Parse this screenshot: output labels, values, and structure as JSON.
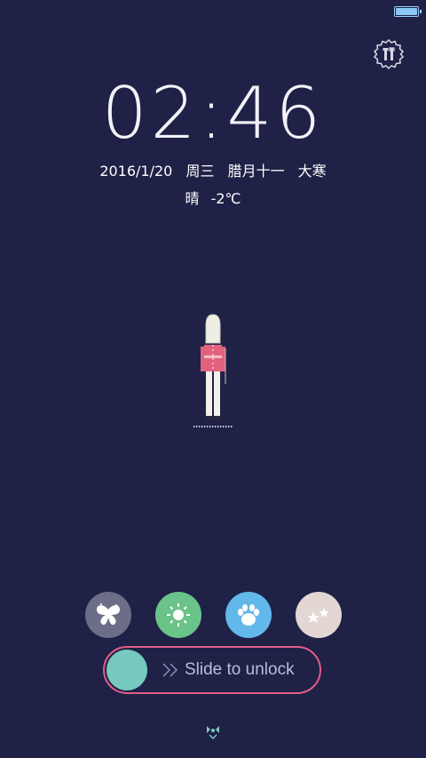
{
  "status_bar": {
    "battery_level": 1.0,
    "battery_color": "#8cc8f5"
  },
  "lockscreen": {
    "time": "02:46",
    "date": "2016/1/20",
    "weekday": "周三",
    "lunar_date": "腊月十一",
    "solar_term": "大寒",
    "weather": "晴",
    "temperature": "-2℃"
  },
  "themes": [
    {
      "icon": "butterfly-icon",
      "color": "#6b6e86"
    },
    {
      "icon": "sun-icon",
      "color": "#6ac388"
    },
    {
      "icon": "paw-icon",
      "color": "#62b8ea"
    },
    {
      "icon": "stars-icon",
      "color": "#e2d7d3"
    }
  ],
  "unlock": {
    "label": "Slide to unlock",
    "border_color": "#e35d87",
    "knob_color": "#76c9be"
  },
  "colors": {
    "background": "#1f2146"
  }
}
